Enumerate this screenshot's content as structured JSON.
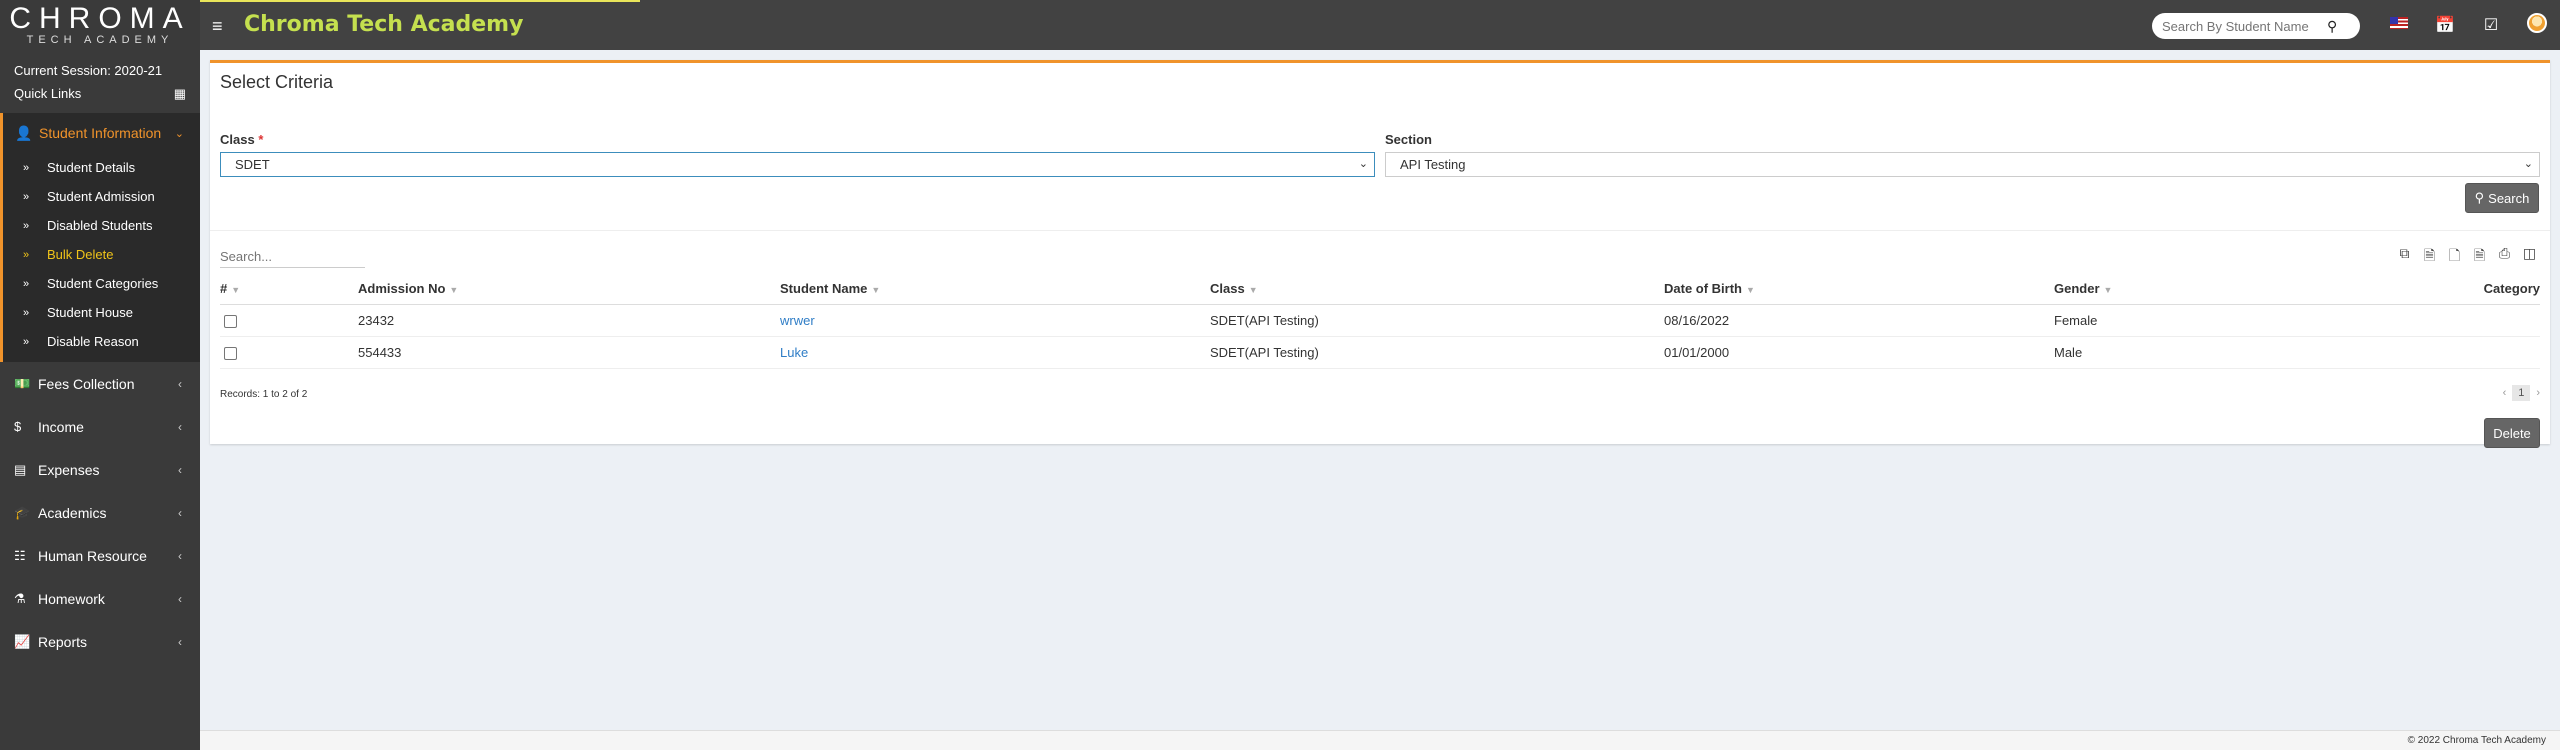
{
  "header": {
    "logo_main": "CHROMA",
    "logo_sub": "TECH ACADEMY",
    "title": "Chroma Tech Academy",
    "search_placeholder": "Search By Student Name"
  },
  "sidebar": {
    "session": "Current Session: 2020-21",
    "quick_links": "Quick Links",
    "open_menu": "Student Information",
    "sub_items": [
      "Student Details",
      "Student Admission",
      "Disabled Students",
      "Bulk Delete",
      "Student Categories",
      "Student House",
      "Disable Reason"
    ],
    "menu_items": [
      "Fees Collection",
      "Income",
      "Expenses",
      "Academics",
      "Human Resource",
      "Homework",
      "Reports"
    ]
  },
  "criteria": {
    "title": "Select Criteria",
    "class_label": "Class",
    "class_required": "*",
    "class_value": "SDET",
    "section_label": "Section",
    "section_value": "API Testing",
    "search_button": "Search"
  },
  "table": {
    "search_placeholder": "Search...",
    "columns": [
      "#",
      "Admission No",
      "Student Name",
      "Class",
      "Date of Birth",
      "Gender",
      "Category"
    ],
    "rows": [
      {
        "admission_no": "23432",
        "name": "wrwer",
        "class": "SDET(API Testing)",
        "dob": "08/16/2022",
        "gender": "Female",
        "category": ""
      },
      {
        "admission_no": "554433",
        "name": "Luke",
        "class": "SDET(API Testing)",
        "dob": "01/01/2000",
        "gender": "Male",
        "category": ""
      }
    ],
    "records": "Records: 1 to 2 of 2",
    "page": "1",
    "prev": "‹",
    "next": "›",
    "delete_button": "Delete"
  },
  "footer": {
    "copyright": "© 2022 Chroma Tech Academy"
  }
}
